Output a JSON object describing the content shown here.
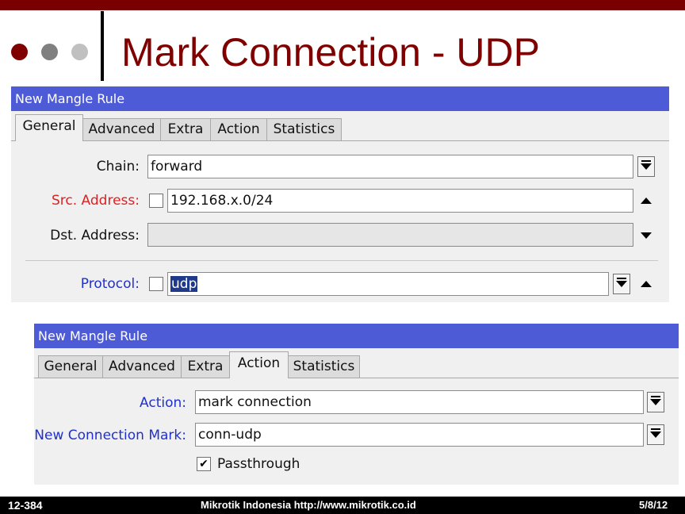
{
  "slide": {
    "title": "Mark Connection - UDP",
    "accent_color": "#7a0000",
    "title_color": "#800000",
    "bullet_colors": [
      "#800000",
      "#808080",
      "#c0c0c0"
    ]
  },
  "window1": {
    "title": "New Mangle Rule",
    "tabs": [
      "General",
      "Advanced",
      "Extra",
      "Action",
      "Statistics"
    ],
    "active_tab": "General",
    "fields": {
      "chain": {
        "label": "Chain:",
        "value": "forward"
      },
      "src_address": {
        "label": "Src. Address:",
        "value": "192.168.x.0/24",
        "invert_checked": false
      },
      "dst_address": {
        "label": "Dst. Address:",
        "value": ""
      },
      "protocol": {
        "label": "Protocol:",
        "value": "udp",
        "invert_checked": false
      }
    }
  },
  "window2": {
    "title": "New Mangle Rule",
    "tabs": [
      "General",
      "Advanced",
      "Extra",
      "Action",
      "Statistics"
    ],
    "active_tab": "Action",
    "fields": {
      "action": {
        "label": "Action:",
        "value": "mark connection"
      },
      "new_connection_mark": {
        "label": "New Connection Mark:",
        "value": "conn-udp"
      },
      "passthrough": {
        "label": "Passthrough",
        "checked": true
      }
    }
  },
  "footer": {
    "left": "12-384",
    "center": "Mikrotik Indonesia http://www.mikrotik.co.id",
    "right": "5/8/12"
  }
}
